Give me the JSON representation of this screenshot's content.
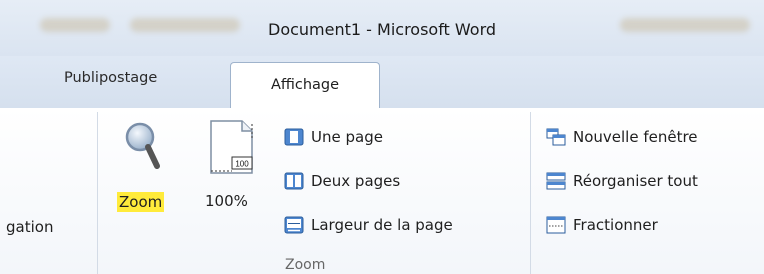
{
  "title_bar": {
    "title": "Document1  -  Microsoft Word"
  },
  "tabs": [
    {
      "label": "Publipostage",
      "active": false
    },
    {
      "label": "Affichage",
      "active": true
    }
  ],
  "ribbon": {
    "previous_group": {
      "label_partial": "gation"
    },
    "zoom_group": {
      "group_label": "Zoom",
      "zoom_button": {
        "label": "Zoom",
        "icon": "magnifier-icon",
        "highlight_color": "#ffeb3b"
      },
      "percent_button": {
        "label": "100%",
        "icon": "page-100-icon"
      },
      "options": [
        {
          "label": "Une page",
          "icon": "one-page-icon"
        },
        {
          "label": "Deux pages",
          "icon": "two-pages-icon"
        },
        {
          "label": "Largeur de la page",
          "icon": "page-width-icon"
        }
      ]
    },
    "window_group": {
      "items": [
        {
          "label": "Nouvelle fenêtre",
          "icon": "new-window-icon"
        },
        {
          "label": "Réorganiser tout",
          "icon": "arrange-all-icon"
        },
        {
          "label": "Fractionner",
          "icon": "split-icon"
        }
      ]
    }
  },
  "colors": {
    "zoom_highlight": "#ffeb3b",
    "accent_blue": "#2b6cc4"
  }
}
